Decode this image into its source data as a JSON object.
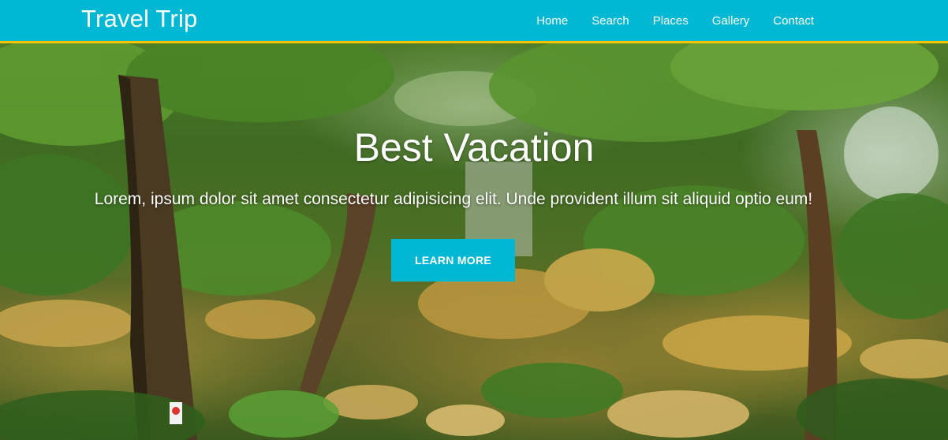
{
  "navbar": {
    "brand": "Travel Trip",
    "links": [
      "Home",
      "Search",
      "Places",
      "Gallery",
      "Contact"
    ]
  },
  "hero": {
    "title": "Best Vacation",
    "text": "Lorem, ipsum dolor sit amet consectetur adipisicing elit. Unde provident illum sit aliquid optio eum!",
    "button_label": "LEARN MORE"
  },
  "colors": {
    "navbar_bg": "#00b8d4",
    "navbar_border": "#f2c500",
    "button_bg": "#00b8d4",
    "text": "#ffffff"
  }
}
